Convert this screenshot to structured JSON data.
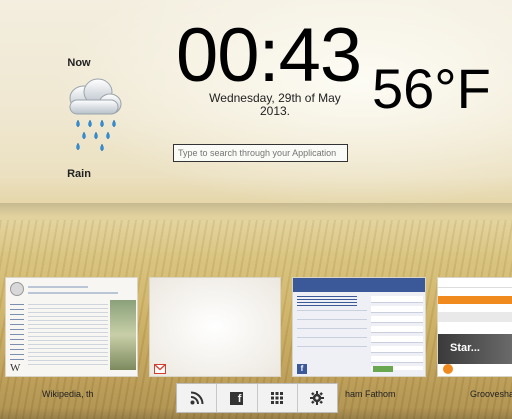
{
  "clock": {
    "time": "00:43",
    "date_line1": "Wednesday, 29th of May",
    "date_line2": "2013."
  },
  "weather": {
    "label_now": "Now",
    "temperature": "56°F",
    "condition": "Rain",
    "icon": "rain-cloud-icon"
  },
  "search": {
    "placeholder": "Type to search through your Application"
  },
  "windows": [
    {
      "title": "Wikipedia, th",
      "kind": "wikipedia"
    },
    {
      "title": "",
      "kind": "gmail"
    },
    {
      "title": "ham Fathom",
      "kind": "facebook"
    },
    {
      "title": "Grooveshar",
      "kind": "grooveshark",
      "thumb_text": "Star..."
    }
  ],
  "dock": [
    {
      "icon": "rss-icon",
      "glyph": ""
    },
    {
      "icon": "facebook-icon",
      "glyph": "f"
    },
    {
      "icon": "apps-grid-icon",
      "glyph": ""
    },
    {
      "icon": "gear-icon",
      "glyph": ""
    }
  ],
  "colors": {
    "clock_text": "#000000",
    "facebook_blue": "#3b5998",
    "grooveshark_orange": "#f08a1e",
    "gmail_red": "#d23f31"
  }
}
